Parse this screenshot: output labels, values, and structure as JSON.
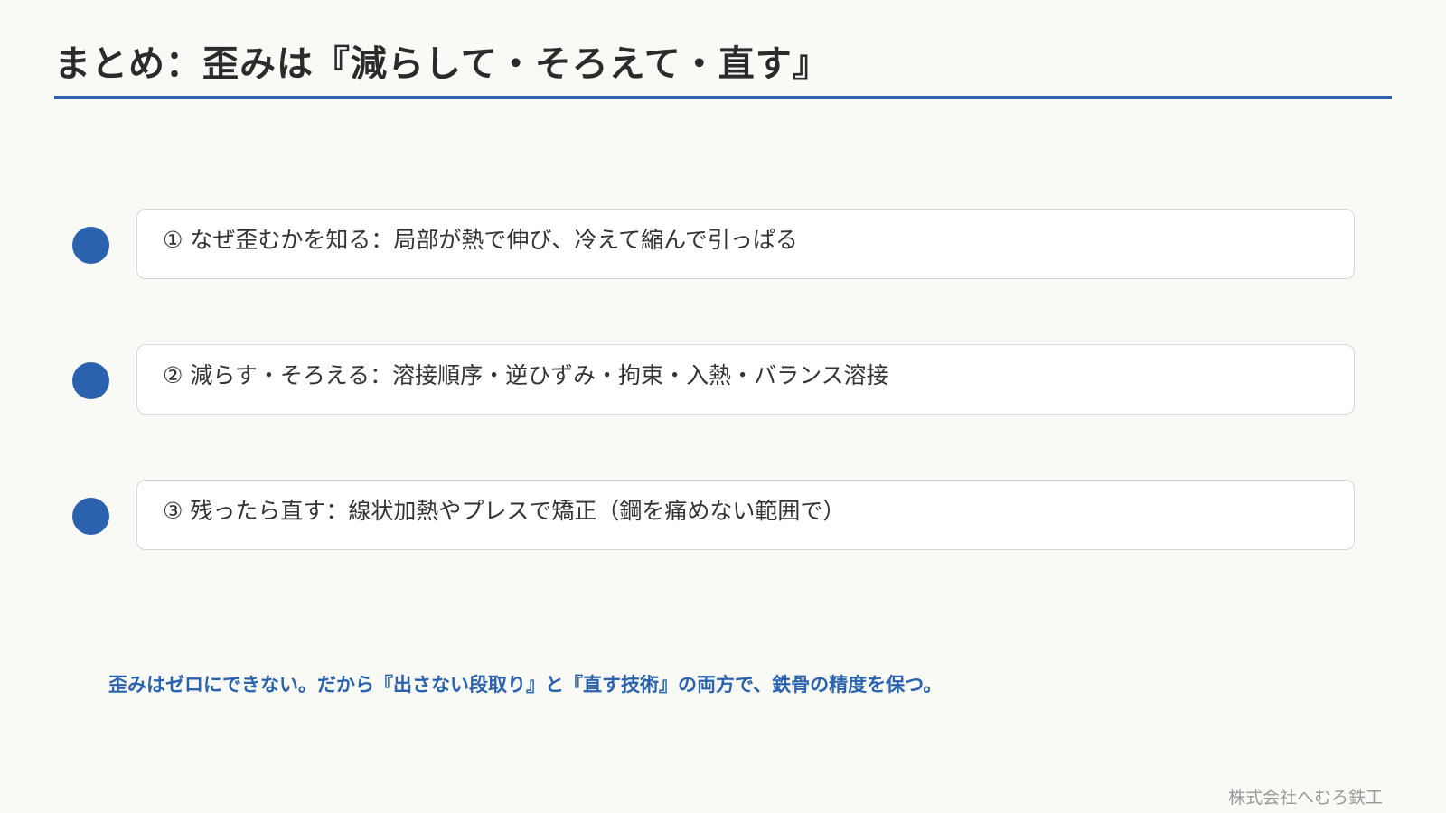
{
  "slide": {
    "title": "まとめ：歪みは『減らして・そろえて・直す』",
    "points": [
      {
        "text": "① なぜ歪むかを知る：局部が熱で伸び、冷えて縮んで引っぱる"
      },
      {
        "text": "② 減らす・そろえる：溶接順序・逆ひずみ・拘束・入熱・バランス溶接"
      },
      {
        "text": "③ 残ったら直す：線状加熱やプレスで矯正（鋼を痛めない範囲で）"
      }
    ],
    "conclusion": "歪みはゼロにできない。だから『出さない段取り』と『直す技術』の両方で、鉄骨の精度を保つ。",
    "footer": "株式会社へむろ鉄工"
  },
  "colors": {
    "accent": "#2b62ad",
    "background": "#f9f9f6",
    "card_border": "#d6d6d6",
    "text": "#333333",
    "footer_text": "#9a9a9a"
  },
  "icons": {
    "bullet": "filled-circle"
  }
}
